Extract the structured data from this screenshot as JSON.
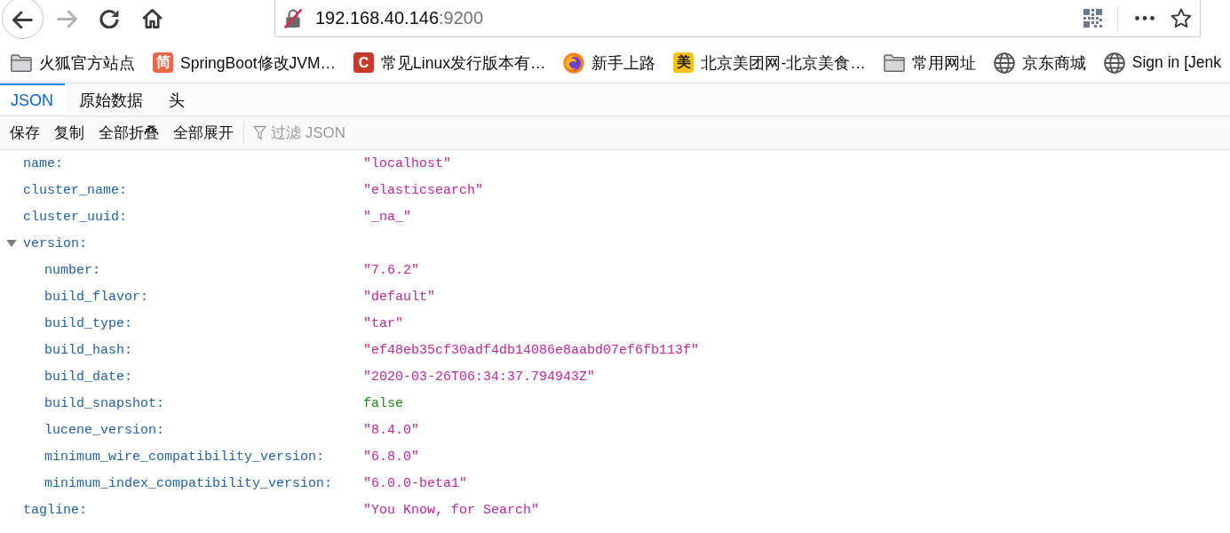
{
  "nav_buttons": [
    {
      "kind": "back",
      "disabled": false
    },
    {
      "kind": "forward",
      "disabled": true
    },
    {
      "kind": "reload",
      "disabled": false
    },
    {
      "kind": "home",
      "disabled": false
    }
  ],
  "address": {
    "insecure": true,
    "host": "192.168.40.146",
    "port": ":9200"
  },
  "bookmarks": [
    {
      "kind": "folder",
      "label": "火狐官方站点"
    },
    {
      "kind": "tile",
      "glyph": "简",
      "color": "#e9684a",
      "label": "SpringBoot修改JVM…"
    },
    {
      "kind": "tile",
      "glyph": "C",
      "color": "#c63a2b",
      "label": "常见Linux发行版本有…"
    },
    {
      "kind": "browser",
      "label": "新手上路"
    },
    {
      "kind": "tile",
      "glyph": "美",
      "color": "#fcc21b",
      "label": "北京美团网-北京美食…"
    },
    {
      "kind": "folder",
      "label": "常用网址"
    },
    {
      "kind": "globe",
      "label": "京东商城"
    },
    {
      "kind": "globe",
      "label": "Sign in [Jenk"
    }
  ],
  "tabs": [
    {
      "label": "JSON",
      "selected": true
    },
    {
      "label": "原始数据",
      "selected": false
    },
    {
      "label": "头",
      "selected": false
    }
  ],
  "toolbar": {
    "buttons": [
      "保存",
      "复制",
      "全部折叠",
      "全部展开"
    ],
    "filter": {
      "placeholder": "过滤 JSON"
    }
  },
  "rows": [
    {
      "kind": "string",
      "key": "name:",
      "value": "\"localhost\""
    },
    {
      "kind": "string",
      "key": "cluster_name:",
      "value": "\"elasticsearch\""
    },
    {
      "kind": "string",
      "key": "cluster_uuid:",
      "value": "\"_na_\""
    },
    {
      "kind": "object",
      "key": "version:",
      "expanded": true,
      "children": [
        {
          "kind": "string",
          "key": "number:",
          "value": "\"7.6.2\""
        },
        {
          "kind": "string",
          "key": "build_flavor:",
          "value": "\"default\""
        },
        {
          "kind": "string",
          "key": "build_type:",
          "value": "\"tar\""
        },
        {
          "kind": "string",
          "key": "build_hash:",
          "value": "\"ef48eb35cf30adf4db14086e8aabd07ef6fb113f\""
        },
        {
          "kind": "string",
          "key": "build_date:",
          "value": "\"2020-03-26T06:34:37.794943Z\""
        },
        {
          "kind": "boolean",
          "key": "build_snapshot:",
          "value": "false"
        },
        {
          "kind": "string",
          "key": "lucene_version:",
          "value": "\"8.4.0\""
        },
        {
          "kind": "string",
          "key": "minimum_wire_compatibility_version:",
          "value": "\"6.8.0\""
        },
        {
          "kind": "string",
          "key": "minimum_index_compatibility_version:",
          "value": "\"6.0.0-beta1\""
        }
      ]
    },
    {
      "kind": "string",
      "key": "tagline:",
      "value": "\"You Know, for Search\""
    }
  ]
}
